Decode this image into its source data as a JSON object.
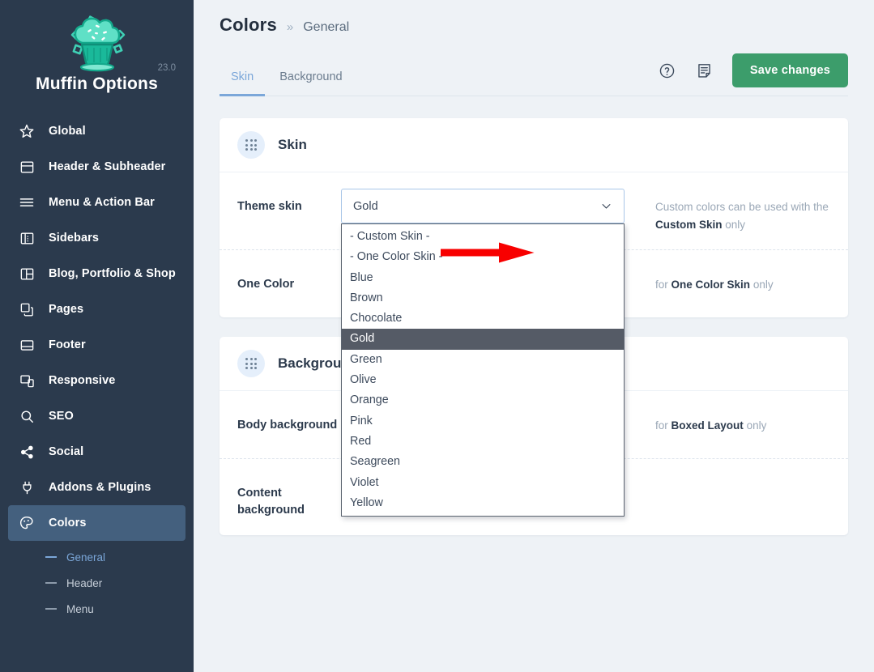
{
  "sidebar": {
    "brand": {
      "title": "Muffin Options",
      "version": "23.0",
      "logo_icon": "cupcake-code-logo"
    },
    "items": [
      {
        "label": "Global",
        "icon": "star-icon",
        "active": false
      },
      {
        "label": "Header & Subheader",
        "icon": "header-layout-icon",
        "active": false
      },
      {
        "label": "Menu & Action Bar",
        "icon": "hamburger-lines-icon",
        "active": false
      },
      {
        "label": "Sidebars",
        "icon": "sidebar-panel-icon",
        "active": false
      },
      {
        "label": "Blog, Portfolio & Shop",
        "icon": "grid-layout-icon",
        "active": false
      },
      {
        "label": "Pages",
        "icon": "copy-pages-icon",
        "active": false
      },
      {
        "label": "Footer",
        "icon": "footer-layout-icon",
        "active": false
      },
      {
        "label": "Responsive",
        "icon": "devices-icon",
        "active": false
      },
      {
        "label": "SEO",
        "icon": "search-icon",
        "active": false
      },
      {
        "label": "Social",
        "icon": "share-icon",
        "active": false
      },
      {
        "label": "Addons & Plugins",
        "icon": "plug-icon",
        "active": false
      },
      {
        "label": "Colors",
        "icon": "palette-icon",
        "active": true
      }
    ],
    "submenu": [
      {
        "label": "General",
        "active": true
      },
      {
        "label": "Header",
        "active": false
      },
      {
        "label": "Menu",
        "active": false
      }
    ]
  },
  "header": {
    "breadcrumb_root": "Colors",
    "breadcrumb_separator": "»",
    "breadcrumb_current": "General",
    "tabs": [
      {
        "label": "Skin",
        "active": true
      },
      {
        "label": "Background",
        "active": false
      }
    ],
    "help_icon": "question-circle-icon",
    "notes_icon": "document-note-icon",
    "save_label": "Save changes",
    "save_color": "#3c9d6b"
  },
  "skin_panel": {
    "title": "Skin",
    "badge_icon": "drag-dots-icon",
    "theme_skin": {
      "label": "Theme skin",
      "value": "Gold",
      "chevron_icon": "chevron-down-icon",
      "help_prefix": "Custom colors can be used with the",
      "help_bold": "Custom Skin",
      "help_suffix": "only",
      "options": [
        "- Custom Skin -",
        "- One Color Skin -",
        "Blue",
        "Brown",
        "Chocolate",
        "Gold",
        "Green",
        "Olive",
        "Orange",
        "Pink",
        "Red",
        "Seagreen",
        "Violet",
        "Yellow"
      ],
      "selected_option": "Gold",
      "selected_bg": "#555b66"
    },
    "one_color": {
      "label": "One Color",
      "help_prefix": "for",
      "help_bold": "One Color Skin",
      "help_suffix": "only"
    }
  },
  "background_panel": {
    "title": "Background",
    "badge_icon": "drag-dots-icon",
    "body_background": {
      "label": "Body background",
      "help_prefix": "for",
      "help_bold": "Boxed Layout",
      "help_suffix": "only"
    },
    "content_background": {
      "label": "Content background",
      "help_prefix": "",
      "help_bold": "",
      "help_suffix": ""
    }
  },
  "annotation": {
    "arrow_icon": "red-right-arrow",
    "color": "#f80000"
  }
}
